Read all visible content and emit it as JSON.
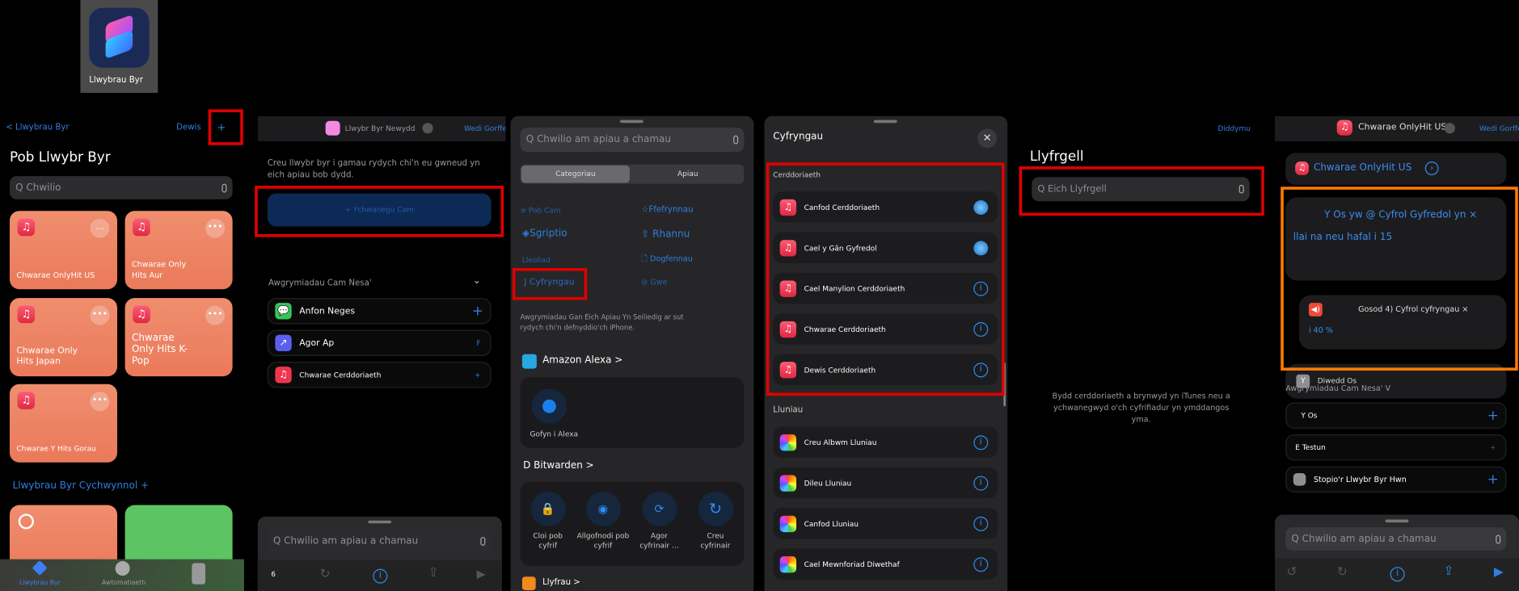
{
  "app_icon": {
    "label": "Llwybrau Byr"
  },
  "panel1": {
    "back": "< Llwybrau Byr",
    "select": "Dewis",
    "add": "+",
    "title": "Pob Llwybr Byr",
    "search_placeholder": "Q Chwilio",
    "tiles": [
      {
        "label": "Chwarae OnlyHit US"
      },
      {
        "label": "Chwarae Only Hits Aur"
      },
      {
        "label": "Chwarae Only Hits Japan"
      },
      {
        "label": "Chwarae Only Hits K-Pop"
      },
      {
        "label": "Chwarae Y Hits Gorau"
      }
    ],
    "starter_heading": "Llwybrau Byr Cychwynnol +",
    "tabs": [
      {
        "label": "Llwybrau Byr"
      },
      {
        "label": "Awtomatiaeth"
      }
    ]
  },
  "panel2": {
    "header_title": "Llwybr Byr Newydd",
    "done": "Wedi Gorffen",
    "intro": "Creu llwybr byr i gamau rydych chi'n eu gwneud yn eich apiau bob dydd.",
    "add_action": "+ Ychwanegu Cam",
    "suggestions_heading": "Awgrymiadau Cam Nesa'",
    "suggestions": [
      {
        "label": "Anfon Neges",
        "color": "#34c759"
      },
      {
        "label": "Agor Ap",
        "color": "#5b5ef0"
      },
      {
        "label": "Chwarae Cerddoriaeth",
        "color": "#f0354f"
      }
    ],
    "search_placeholder": "Q Chwilio am apiau a chamau",
    "toolbar_count": "6"
  },
  "panel3": {
    "search_placeholder": "Q Chwilio am apiau a chamau",
    "segments": [
      "Categoriau",
      "Apiau"
    ],
    "categories": [
      {
        "label": "≡ Pob Cam"
      },
      {
        "label": "Ffefrynnau"
      },
      {
        "label": "Sgriptio"
      },
      {
        "label": "Rhannu"
      },
      {
        "label": "Lleoliad"
      },
      {
        "label": "Dogfennau"
      },
      {
        "label": "J Cyfryngau"
      },
      {
        "label": "Gwe"
      }
    ],
    "description": "Awgrymiadau Gan Eich Apiau Yn Seiliedig ar sut rydych chi'n defnyddio'ch iPhone.",
    "alexa_heading": "Amazon Alexa >",
    "alexa_action": "Gofyn i Alexa",
    "bitwarden_heading": "D Bitwarden >",
    "bitwarden_actions": [
      "Cloi pob cyfrif",
      "Allgofnodi pob cyfrif",
      "Agor cyfrinair ...",
      "Creu cyfrinair"
    ],
    "books_heading": "Llyfrau >"
  },
  "panel4": {
    "title": "Cyfryngau",
    "music_heading": "Cerddoriaeth",
    "music": [
      "Canfod Cerddoriaeth",
      "Cael y Gân Gyfredol",
      "Cael Manylion Cerddoriaeth",
      "Chwarae Cerddoriaeth",
      "Dewis Cerddoriaeth"
    ],
    "photos_heading": "Lluniau",
    "photos": [
      "Creu Albwm Lluniau",
      "Dileu Lluniau",
      "Canfod Lluniau",
      "Cael Mewnforiad Diwethaf"
    ]
  },
  "panel5": {
    "cancel": "Diddymu",
    "title": "Llyfrgell",
    "search_placeholder": "Q Eich Llyfrgell",
    "empty_message": "Bydd cerddoriaeth a brynwyd yn iTunes neu a ychwanegwyd o'ch cyfrifiadur yn ymddangos yma."
  },
  "panel6": {
    "header_title": "Chwarae OnlyHit US",
    "done": "Wedi Gorffen",
    "action": "Chwarae OnlyHit US",
    "if_line1": "Y Os yw @ Cyfrol Gyfredol yn ×",
    "if_line2": "llai na neu hafal i 15",
    "set_line1": "Gosod 4) Cyfrol cyfryngau ×",
    "set_line2": "i 40 %",
    "end_if": "Diwedd Os",
    "suggestions_heading": "Awgrymiadau Cam Nesa' V",
    "suggestions": [
      "Y Os",
      "E Testun",
      "Stopio'r Llwybr Byr Hwn"
    ],
    "search_placeholder": "Q Chwilio am apiau a chamau"
  },
  "colors": {
    "accent": "#2f7fe0",
    "highlight_red": "#e00000",
    "highlight_orange": "#ff7a00",
    "tile": "#ec8464"
  }
}
